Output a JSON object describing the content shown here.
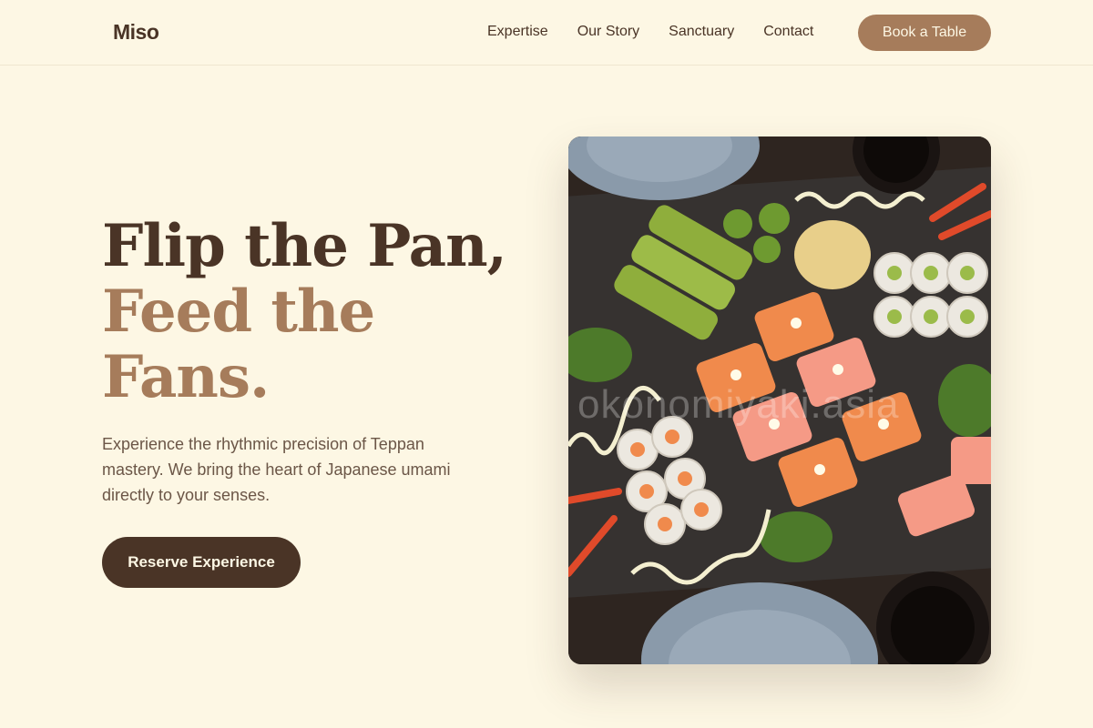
{
  "brand": {
    "logo": "Miso"
  },
  "nav": {
    "links": [
      "Expertise",
      "Our Story",
      "Sanctuary",
      "Contact"
    ],
    "cta": "Book a Table"
  },
  "hero": {
    "title_line_1": "Flip the Pan,",
    "title_line_2": "Feed the",
    "title_line_3": "Fans.",
    "description": "Experience the rhythmic precision of Teppan mastery. We bring the heart of Japanese umami directly to your senses.",
    "cta": "Reserve Experience",
    "image": {
      "subject": "sushi-platter-photo",
      "watermark": "okonomiyaki.asia"
    }
  },
  "colors": {
    "background": "#fdf7e4",
    "primary_dark": "#4a3426",
    "accent": "#a67c5b",
    "body_text": "#6b5647"
  }
}
